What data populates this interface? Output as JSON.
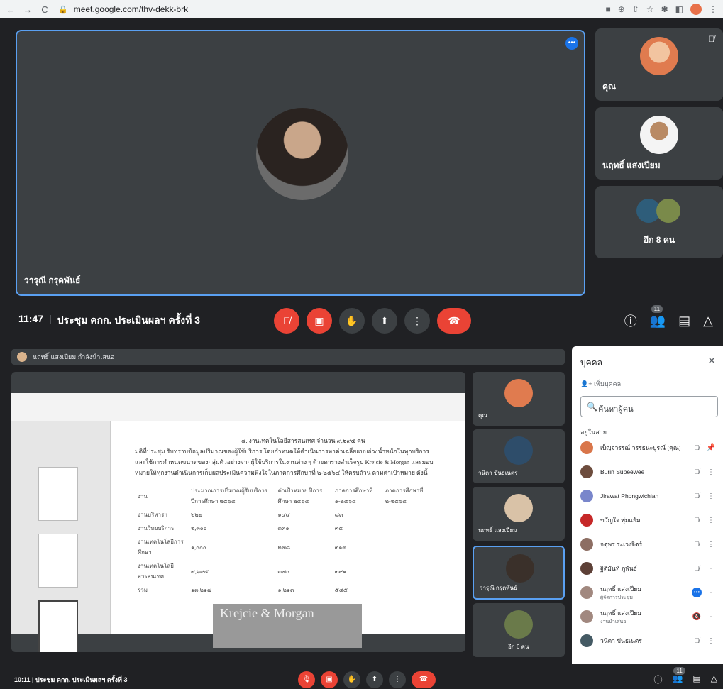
{
  "browser": {
    "url": "meet.google.com/thv-dekk-brk",
    "nav_icons": [
      "←",
      "→",
      "C"
    ]
  },
  "main_view": {
    "speaker_name": "วารุณี กรุดพันธ์"
  },
  "side_tiles": [
    {
      "name": "คุณ"
    },
    {
      "name": "นฤทธิ์ แสงเปียม"
    },
    {
      "name": "อีก 8 คน"
    }
  ],
  "control_bar": {
    "time": "11:47",
    "separator": "|",
    "meeting_title": "ประชุม คกก. ประเมินผลฯ ครั้งที่ 3",
    "people_count": "11"
  },
  "lower_meet": {
    "presenter_text": "นฤทธิ์ แสงเปียม กำลังนำเสนอ",
    "doc": {
      "line1": "๔. งานเทคโนโลยีสารสนเทศ จำนวน ๙,๖๙๕ คน",
      "para": "มติที่ประชุม รับทราบข้อมูลปริมาณของผู้ใช้บริการ โดยกำหนดให้ดำเนินการหาค่าเฉลี่ยแบบถ่วงน้ำหนักในทุกบริการ และใช้การกำหนดขนาดของกลุ่มตัวอย่างจากผู้ใช้บริการในงานต่าง ๆ ด้วยตารางสำเร็จรูป Krejcie & Morgan และมอบหมายให้ทุกงานดำเนินการเก็บผลประเมินความพึงใจในภาคการศึกษาที่ ๒-๒๕๖๔ ให้ครบถ้วน ตามค่าเป้าหมาย ดังนี้",
      "table_header": [
        "งาน",
        "ประมาณการปริมาณผู้รับบริการ ปีการศึกษา ๒๕๖๔",
        "ค่าเป้าหมาย ปีการศึกษา ๒๕๖๔",
        "ภาคการศึกษาที่ ๑-๒๕๖๔",
        "ภาคการศึกษาที่ ๒-๒๕๖๔"
      ],
      "table_rows": [
        [
          "งานบริหารฯ",
          "๒๒๒",
          "๑๔๔",
          "๘๓",
          ""
        ],
        [
          "งานวิทยบริการ",
          "๒,๓๐๐",
          "๓๓๑",
          "๓๕",
          ""
        ],
        [
          "งานเทคโนโลยีการศึกษา",
          "๑,๐๐๐",
          "๒๗๘",
          "๓๑๓",
          ""
        ],
        [
          "งานเทคโนโลยีสารสนเทศ",
          "๙,๖๙๕",
          "๓๗๐",
          "๓๙๑",
          ""
        ],
        [
          "รวม",
          "๑๓,๒๑๗",
          "๑,๒๑๓",
          "๕๔๕",
          ""
        ]
      ],
      "banner": "Krejcie & Morgan"
    },
    "tiles": [
      {
        "name": "คุณ"
      },
      {
        "name": "วนิดา ขันธเนตร"
      },
      {
        "name": "นฤทธิ์ แสงเปียม"
      },
      {
        "name": "วารุณี กรุดพันธ์"
      },
      {
        "name": "อีก 6 คน"
      }
    ],
    "meeting_info": "10:11 | ประชุม คกก. ประเมินผลฯ ครั้งที่ 3",
    "people_count": "11"
  },
  "people_panel": {
    "title": "บุคคล",
    "add": "เพิ่มบุคคล",
    "search_placeholder": "ค้นหาผู้คน",
    "section": "อยู่ในสาย",
    "people": [
      {
        "name": "เบ็ญจวรรณ์ วรรธนะบูรณ์ (คุณ)",
        "sub": "",
        "color": "#d9764a"
      },
      {
        "name": "Burin Supeewee",
        "sub": "",
        "color": "#6d4c3d"
      },
      {
        "name": "Jirawat Phongwichian",
        "sub": "",
        "color": "#7986cb"
      },
      {
        "name": "ขวัญใจ พุ่มแย้ม",
        "sub": "",
        "color": "#c62828"
      },
      {
        "name": "จตุพร ระเวงจิตร์",
        "sub": "",
        "color": "#8d6e63"
      },
      {
        "name": "ฐิติมันท์ ภูพันธ์",
        "sub": "",
        "color": "#5d4037"
      },
      {
        "name": "นฤทธิ์ แสงเปียม",
        "sub": "ผู้จัดการประชุม",
        "color": "#a1887f"
      },
      {
        "name": "นฤทธิ์ แสงเปียม",
        "sub": "งานนำเสนอ",
        "color": "#a1887f"
      },
      {
        "name": "วนิดา ขันธเนตร",
        "sub": "",
        "color": "#455a64"
      }
    ]
  }
}
